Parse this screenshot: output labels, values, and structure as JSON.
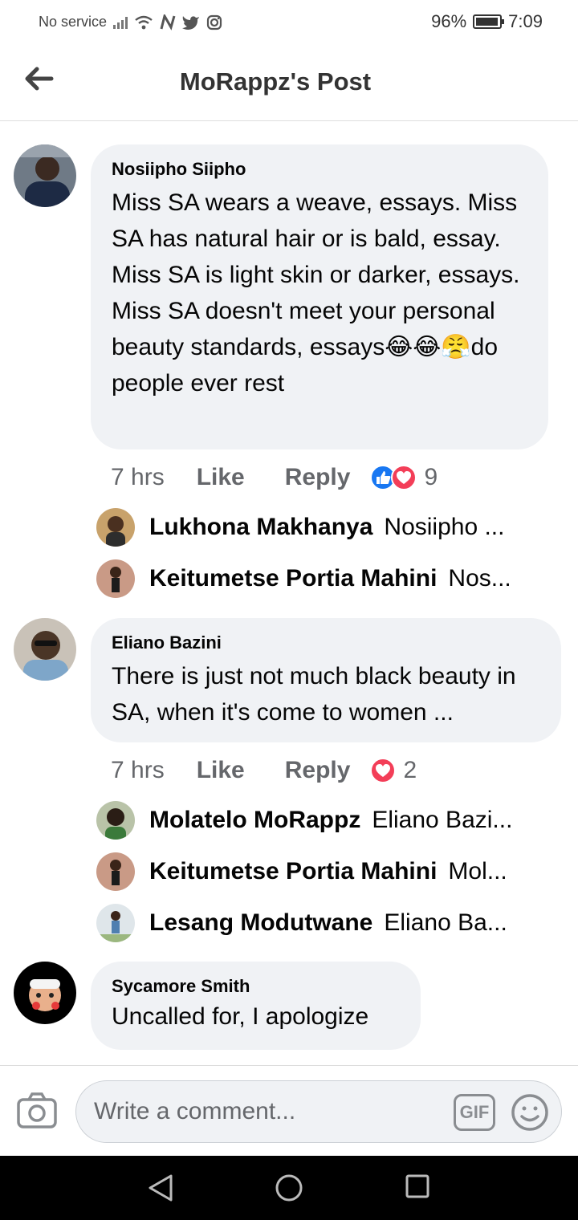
{
  "status_bar": {
    "carrier": "No service",
    "battery": "96%",
    "battery_level": 0.96,
    "time": "7:09"
  },
  "header": {
    "title": "MoRappz's Post"
  },
  "comments": [
    {
      "author": "Nosiipho Siipho",
      "text": "Miss SA wears a weave, essays. Miss SA has natural hair or is bald, essay. Miss SA is light skin or darker, essays. Miss SA doesn't meet your personal beauty standards, essays😂😂😤do people ever rest",
      "time": "7 hrs",
      "like_label": "Like",
      "reply_label": "Reply",
      "reaction_count": "9",
      "replies": [
        {
          "name": "Lukhona Makhanya",
          "text": "Nosiipho ..."
        },
        {
          "name": "Keitumetse Portia Mahini",
          "text": "Nos..."
        }
      ]
    },
    {
      "author": "Eliano Bazini",
      "text": "There is just not much black beauty in SA, when it's come to women ...",
      "time": "7 hrs",
      "like_label": "Like",
      "reply_label": "Reply",
      "reaction_count": "2",
      "replies": [
        {
          "name": "Molatelo MoRappz",
          "text": "Eliano Bazi..."
        },
        {
          "name": "Keitumetse Portia Mahini",
          "text": "Mol..."
        },
        {
          "name": "Lesang Modutwane",
          "text": "Eliano Ba..."
        }
      ]
    },
    {
      "author": "Sycamore Smith",
      "text": "Uncalled for, I apologize"
    }
  ],
  "composer": {
    "placeholder": "Write a comment...",
    "gif_label": "GIF"
  },
  "colors": {
    "bubble": "#f0f2f5",
    "like_blue": "#1877f2",
    "love_red": "#f33e58",
    "secondary_text": "#65676b"
  }
}
